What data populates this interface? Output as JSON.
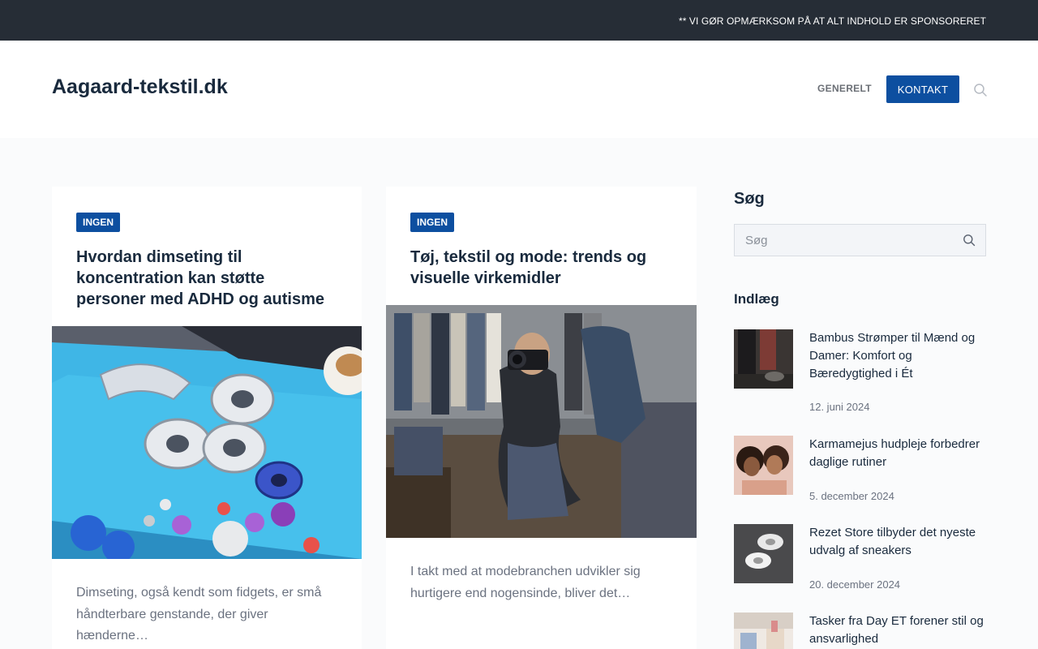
{
  "topbar": {
    "notice": "** VI GØR OPMÆRKSOM PÅ AT ALT INDHOLD ER SPONSORERET"
  },
  "header": {
    "site_title": "Aagaard-tekstil.dk",
    "nav": {
      "generelt": "GENERELT",
      "kontakt": "KONTAKT"
    },
    "search_icon": "search-icon"
  },
  "colors": {
    "accent": "#0d4fa0",
    "topbar": "#262d36",
    "page_bg": "#fafbfc"
  },
  "articles": [
    {
      "category": "INGEN",
      "title": "Hvordan dimseting til koncentration kan støtte personer med ADHD og autisme",
      "excerpt": "Dimseting, også kendt som fidgets, er små håndterbare genstande, der giver hænderne…"
    },
    {
      "category": "INGEN",
      "title": "Tøj, tekstil og mode: trends og visuelle virkemidler",
      "excerpt": "I takt med at modebranchen udvikler sig hurtigere end nogensinde, bliver det…"
    }
  ],
  "sidebar": {
    "search_title": "Søg",
    "search_placeholder": "Søg",
    "posts_title": "Indlæg",
    "posts": [
      {
        "title": "Bambus Strømper til Mænd og Damer: Komfort og Bæredygtighed i Ét",
        "date": "12. juni 2024"
      },
      {
        "title": "Karmamejus hudpleje forbedrer daglige rutiner",
        "date": "5. december 2024"
      },
      {
        "title": "Rezet Store tilbyder det nyeste udvalg af sneakers",
        "date": "20. december 2024"
      },
      {
        "title": "Tasker fra Day ET forener stil og ansvarlighed",
        "date": ""
      }
    ]
  }
}
